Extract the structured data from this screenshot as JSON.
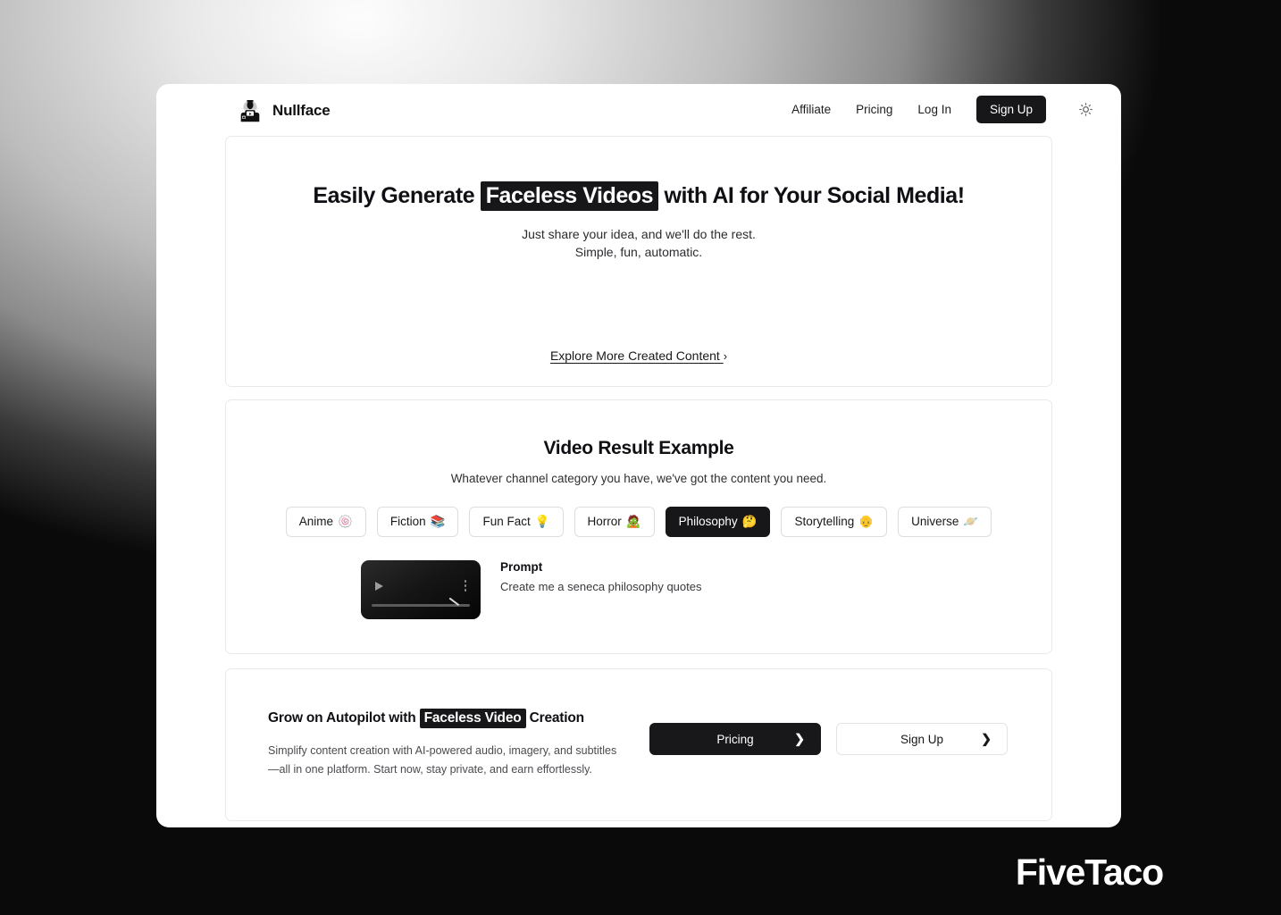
{
  "brand": {
    "name": "Nullface",
    "logo_icon": "faceless-person-video-logo"
  },
  "nav": {
    "links": [
      {
        "label": "Affiliate",
        "name": "affiliate"
      },
      {
        "label": "Pricing",
        "name": "pricing"
      },
      {
        "label": "Log In",
        "name": "login"
      }
    ],
    "signup_label": "Sign Up",
    "theme_toggle_icon": "sun-icon"
  },
  "hero": {
    "title_pre": "Easily Generate ",
    "title_mark": "Faceless Videos",
    "title_post": " with AI for Your Social Media!",
    "sub1": "Just share your idea, and we'll do the rest.",
    "sub2": "Simple, fun, automatic.",
    "explore_label": "Explore More Created Content ",
    "explore_chevron": "›"
  },
  "example": {
    "title": "Video Result Example",
    "subtitle": "Whatever channel category you have, we've got the content you need.",
    "chips": [
      {
        "label": "Anime",
        "emoji": "🍥",
        "active": false,
        "name": "anime"
      },
      {
        "label": "Fiction",
        "emoji": "📚",
        "active": false,
        "name": "fiction"
      },
      {
        "label": "Fun Fact",
        "emoji": "💡",
        "active": false,
        "name": "fun-fact"
      },
      {
        "label": "Horror",
        "emoji": "🧟",
        "active": false,
        "name": "horror"
      },
      {
        "label": "Philosophy",
        "emoji": "🤔",
        "active": true,
        "name": "philosophy"
      },
      {
        "label": "Storytelling",
        "emoji": "👴",
        "active": false,
        "name": "storytelling"
      },
      {
        "label": "Universe",
        "emoji": "🪐",
        "active": false,
        "name": "universe"
      }
    ],
    "prompt_label": "Prompt",
    "prompt_text": "Create me a seneca philosophy quotes",
    "player": {
      "play_icon": "play-icon",
      "menu_icon": "kebab-menu-icon"
    }
  },
  "cta": {
    "title_pre": "Grow on Autopilot with ",
    "title_mark": "Faceless Video",
    "title_post": " Creation",
    "description": "Simplify content creation with AI-powered audio, imagery, and subtitles—all in one platform. Start now, stay private, and earn effortlessly.",
    "pricing_label": "Pricing",
    "signup_label": "Sign Up",
    "chevron": "❯"
  },
  "watermark": {
    "text": "FiveTaco"
  },
  "colors": {
    "accent_dark": "#17171a",
    "card_border": "#e9e9e9",
    "text_primary": "#101014",
    "text_secondary": "#4b4b50"
  }
}
